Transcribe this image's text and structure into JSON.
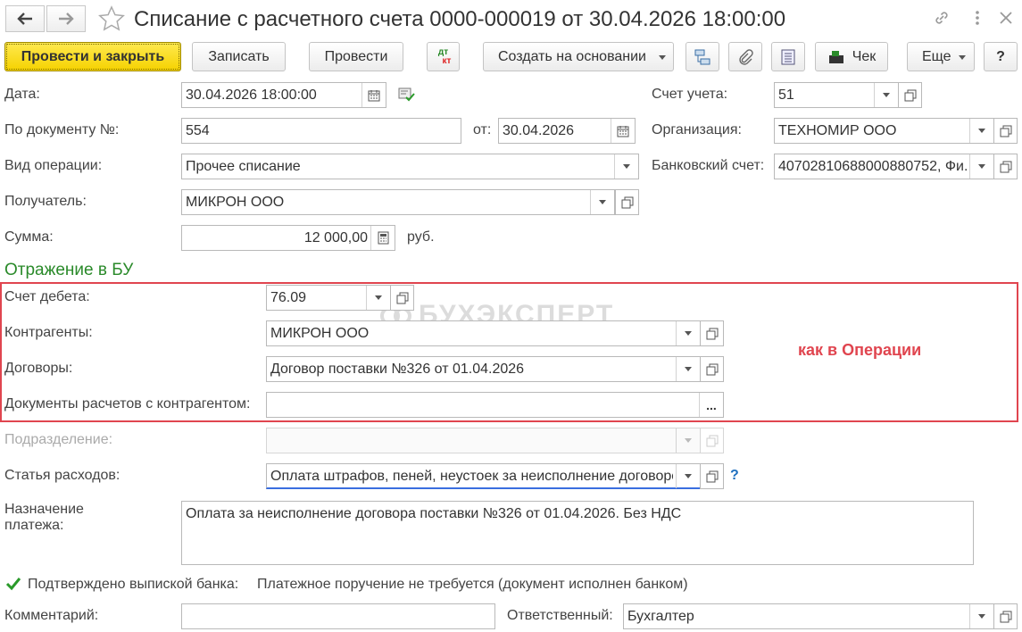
{
  "window": {
    "title": "Списание с расчетного счета 0000-000019 от 30.04.2026 18:00:00"
  },
  "toolbar": {
    "post_and_close": "Провести и закрыть",
    "save": "Записать",
    "post": "Провести",
    "dt_kt_top": "дт",
    "dt_kt_bottom": "кт",
    "create_based_on": "Создать на основании",
    "receipt": "Чек",
    "more": "Еще",
    "help": "?"
  },
  "form": {
    "date": {
      "label": "Дата:",
      "value": "30.04.2026 18:00:00"
    },
    "doc_number": {
      "label": "По документу №:",
      "value": "554"
    },
    "doc_date": {
      "label": "от:",
      "value": "30.04.2026"
    },
    "operation_type": {
      "label": "Вид операции:",
      "value": "Прочее списание"
    },
    "recipient": {
      "label": "Получатель:",
      "value": "МИКРОН ООО"
    },
    "amount": {
      "label": "Сумма:",
      "value": "12 000,00",
      "currency": "руб."
    },
    "account": {
      "label": "Счет учета:",
      "value": "51"
    },
    "organization": {
      "label": "Организация:",
      "value": "ТЕХНОМИР ООО"
    },
    "bank_account": {
      "label": "Банковский счет:",
      "value": "40702810688000880752, Фи..."
    }
  },
  "accounting": {
    "section_title": "Отражение в БУ",
    "debit_account": {
      "label": "Счет дебета:",
      "value": "76.09"
    },
    "counterparties": {
      "label": "Контрагенты:",
      "value": "МИКРОН ООО"
    },
    "contracts": {
      "label": "Договоры:",
      "value": "Договор поставки №326 от 01.04.2026"
    },
    "settlement_docs": {
      "label": "Документы расчетов с контрагентом:",
      "value": "",
      "pick": "..."
    },
    "note": "как в Операции",
    "watermark": "БУХЭКСПЕРТ"
  },
  "lower": {
    "department": {
      "label": "Подразделение:",
      "value": ""
    },
    "expense_item": {
      "label": "Статья расходов:",
      "value": "Оплата штрафов, пеней, неустоек за неисполнение договоров",
      "help": "?"
    },
    "purpose": {
      "label_line1": "Назначение",
      "label_line2": "платежа:",
      "value": "Оплата за неисполнение договора поставки №326 от 01.04.2026. Без НДС"
    },
    "confirmed": {
      "label": "Подтверждено выпиской банка:",
      "checked": true,
      "status": "Платежное поручение не требуется (документ исполнен банком)"
    },
    "comment": {
      "label": "Комментарий:",
      "value": ""
    },
    "responsible": {
      "label": "Ответственный:",
      "value": "Бухгалтер"
    }
  },
  "colors": {
    "primary_button": "#f5d200",
    "section_title": "#2a8a2a",
    "highlight": "#e0454f",
    "help": "#1e6fbf"
  }
}
